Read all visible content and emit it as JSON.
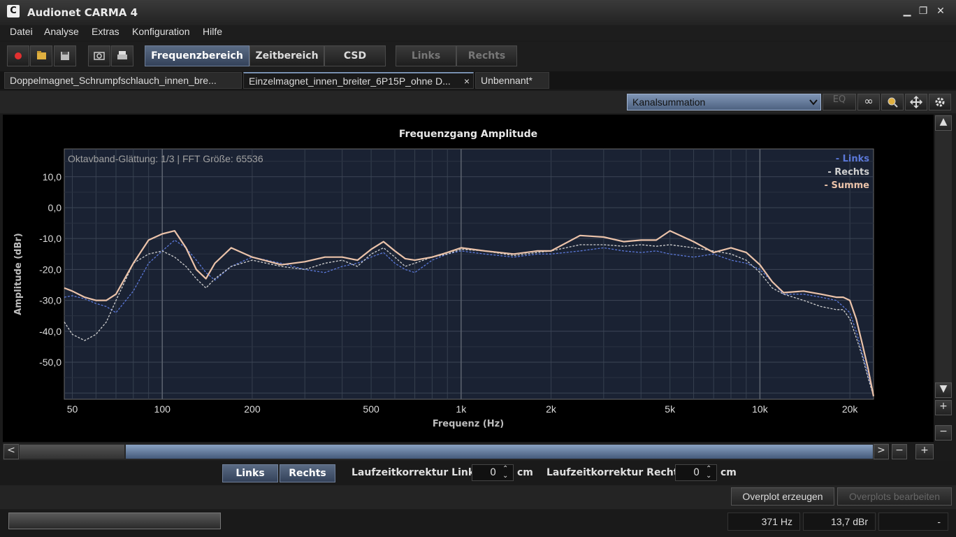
{
  "window": {
    "title": "Audionet CARMA 4",
    "icon": "C"
  },
  "menu": [
    "Datei",
    "Analyse",
    "Extras",
    "Konfiguration",
    "Hilfe"
  ],
  "toolbar": {
    "views": [
      {
        "label": "Frequenzbereich",
        "active": true
      },
      {
        "label": "Zeitbereich",
        "active": false
      },
      {
        "label": "CSD",
        "active": false
      }
    ],
    "channels": [
      {
        "label": "Links",
        "enabled": false
      },
      {
        "label": "Rechts",
        "enabled": false
      }
    ]
  },
  "tabs": [
    {
      "label": "Doppelmagnet_Schrumpfschlauch_innen_bre...",
      "active": false
    },
    {
      "label": "Einzelmagnet_innen_breiter_6P15P_ohne D...",
      "active": true,
      "close": "×"
    },
    {
      "label": "Unbennant*",
      "active": false
    }
  ],
  "options": {
    "select_value": "Kanalsummation",
    "eq_label": "EQ",
    "link_icon": "∞"
  },
  "chart_data": {
    "type": "line",
    "title": "Frequenzgang Amplitude",
    "xlabel": "Frequenz (Hz)",
    "ylabel": "Amplitude (dBr)",
    "info": "Oktavband-Glättung: 1/3 | FFT Größe: 65536",
    "x_scale": "log",
    "xlim": [
      47,
      24000
    ],
    "ylim": [
      -62,
      19
    ],
    "x_ticks": [
      {
        "value": 50,
        "label": "50"
      },
      {
        "value": 100,
        "label": "100"
      },
      {
        "value": 200,
        "label": "200"
      },
      {
        "value": 500,
        "label": "500"
      },
      {
        "value": 1000,
        "label": "1k"
      },
      {
        "value": 2000,
        "label": "2k"
      },
      {
        "value": 5000,
        "label": "5k"
      },
      {
        "value": 10000,
        "label": "10k"
      },
      {
        "value": 20000,
        "label": "20k"
      }
    ],
    "y_ticks": [
      {
        "value": 10,
        "label": "10,0"
      },
      {
        "value": 0,
        "label": "0,0"
      },
      {
        "value": -10,
        "label": "-10,0"
      },
      {
        "value": -20,
        "label": "-20,0"
      },
      {
        "value": -30,
        "label": "-30,0"
      },
      {
        "value": -40,
        "label": "-40,0"
      },
      {
        "value": -50,
        "label": "-50,0"
      }
    ],
    "grid": true,
    "legend_position": "top-right",
    "series": [
      {
        "name": "- Links",
        "color": "#5b78d8",
        "dash": "3,2",
        "x": [
          47,
          50,
          55,
          60,
          65,
          70,
          80,
          90,
          100,
          110,
          120,
          130,
          140,
          150,
          170,
          200,
          250,
          300,
          350,
          400,
          450,
          500,
          550,
          600,
          650,
          700,
          800,
          900,
          1000,
          1200,
          1500,
          1800,
          2000,
          2500,
          3000,
          3500,
          4000,
          4500,
          5000,
          6000,
          7000,
          8000,
          9000,
          10000,
          11000,
          12000,
          14000,
          16000,
          18000,
          19000,
          20000,
          21000,
          22000,
          23000,
          24000
        ],
        "y": [
          -29,
          -28.5,
          -29.5,
          -31,
          -32,
          -34,
          -27,
          -18,
          -14,
          -10.5,
          -13,
          -17,
          -21,
          -23.5,
          -19,
          -16,
          -18,
          -20,
          -21,
          -19,
          -18,
          -16,
          -14.5,
          -18,
          -20,
          -21,
          -17,
          -15,
          -14,
          -15,
          -16,
          -15,
          -15,
          -14,
          -13,
          -14,
          -14.5,
          -14,
          -15,
          -16,
          -15,
          -17,
          -18,
          -20,
          -24,
          -28,
          -28,
          -29,
          -30,
          -32,
          -34,
          -40,
          -47,
          -54,
          -61
        ]
      },
      {
        "name": "- Rechts",
        "color": "#d0d0d0",
        "dash": "3,2",
        "x": [
          47,
          50,
          55,
          60,
          65,
          70,
          80,
          90,
          100,
          110,
          120,
          130,
          140,
          150,
          170,
          200,
          250,
          300,
          350,
          400,
          450,
          500,
          550,
          600,
          650,
          700,
          800,
          900,
          1000,
          1200,
          1500,
          1800,
          2000,
          2500,
          3000,
          3500,
          4000,
          4500,
          5000,
          6000,
          7000,
          8000,
          9000,
          10000,
          11000,
          12000,
          14000,
          16000,
          18000,
          19000,
          20000,
          21000,
          22000,
          23000,
          24000
        ],
        "y": [
          -37,
          -41,
          -43,
          -41,
          -37,
          -30,
          -18,
          -15,
          -14,
          -16,
          -19,
          -23,
          -26,
          -23,
          -19,
          -17,
          -19,
          -20,
          -18,
          -17,
          -19,
          -15,
          -13,
          -16,
          -19,
          -18,
          -16,
          -15,
          -13.5,
          -14,
          -15.5,
          -14.5,
          -14,
          -12,
          -12,
          -12.5,
          -12,
          -12.5,
          -12,
          -13,
          -14,
          -15,
          -17,
          -21,
          -26,
          -28,
          -30,
          -32,
          -33,
          -33,
          -36,
          -42,
          -48,
          -55,
          -61
        ]
      },
      {
        "name": "- Summe",
        "color": "#ebc3aa",
        "dash": "",
        "x": [
          47,
          50,
          55,
          60,
          65,
          70,
          80,
          90,
          100,
          110,
          120,
          130,
          140,
          150,
          170,
          200,
          250,
          300,
          350,
          400,
          450,
          500,
          550,
          600,
          650,
          700,
          800,
          900,
          1000,
          1200,
          1500,
          1800,
          2000,
          2500,
          3000,
          3500,
          4000,
          4500,
          5000,
          6000,
          7000,
          8000,
          9000,
          10000,
          11000,
          12000,
          14000,
          16000,
          18000,
          19000,
          20000,
          21000,
          22000,
          23000,
          24000
        ],
        "y": [
          -26,
          -27,
          -29,
          -30,
          -30,
          -28,
          -18,
          -10.5,
          -8.5,
          -7.5,
          -13,
          -20,
          -23,
          -18,
          -13,
          -16,
          -18.5,
          -17.5,
          -16,
          -16,
          -17,
          -13.5,
          -11,
          -14,
          -16.5,
          -17,
          -16,
          -14.5,
          -13,
          -14,
          -15,
          -14,
          -14,
          -9,
          -9.5,
          -11,
          -10.5,
          -10.5,
          -7.5,
          -11,
          -14.5,
          -13,
          -14.5,
          -18.5,
          -24,
          -27.5,
          -27,
          -28,
          -29,
          -29,
          -30,
          -36,
          -44,
          -52,
          -61
        ]
      }
    ]
  },
  "bottom": {
    "links_btn": "Links",
    "rechts_btn": "Rechts",
    "delay_left_label": "Laufzeitkorrektur Links",
    "delay_left_value": "0",
    "delay_right_label": "Laufzeitkorrektur Rechts",
    "delay_right_value": "0",
    "unit": "cm",
    "overplot_create": "Overplot erzeugen",
    "overplot_edit": "Overplots bearbeiten"
  },
  "status": {
    "freq": "371 Hz",
    "level": "13,7 dBr",
    "extra": "-"
  },
  "scrollbar_glyphs": {
    "up": "▲",
    "down": "▼",
    "left": "<",
    "right": ">",
    "minus": "−",
    "plus": "+"
  }
}
